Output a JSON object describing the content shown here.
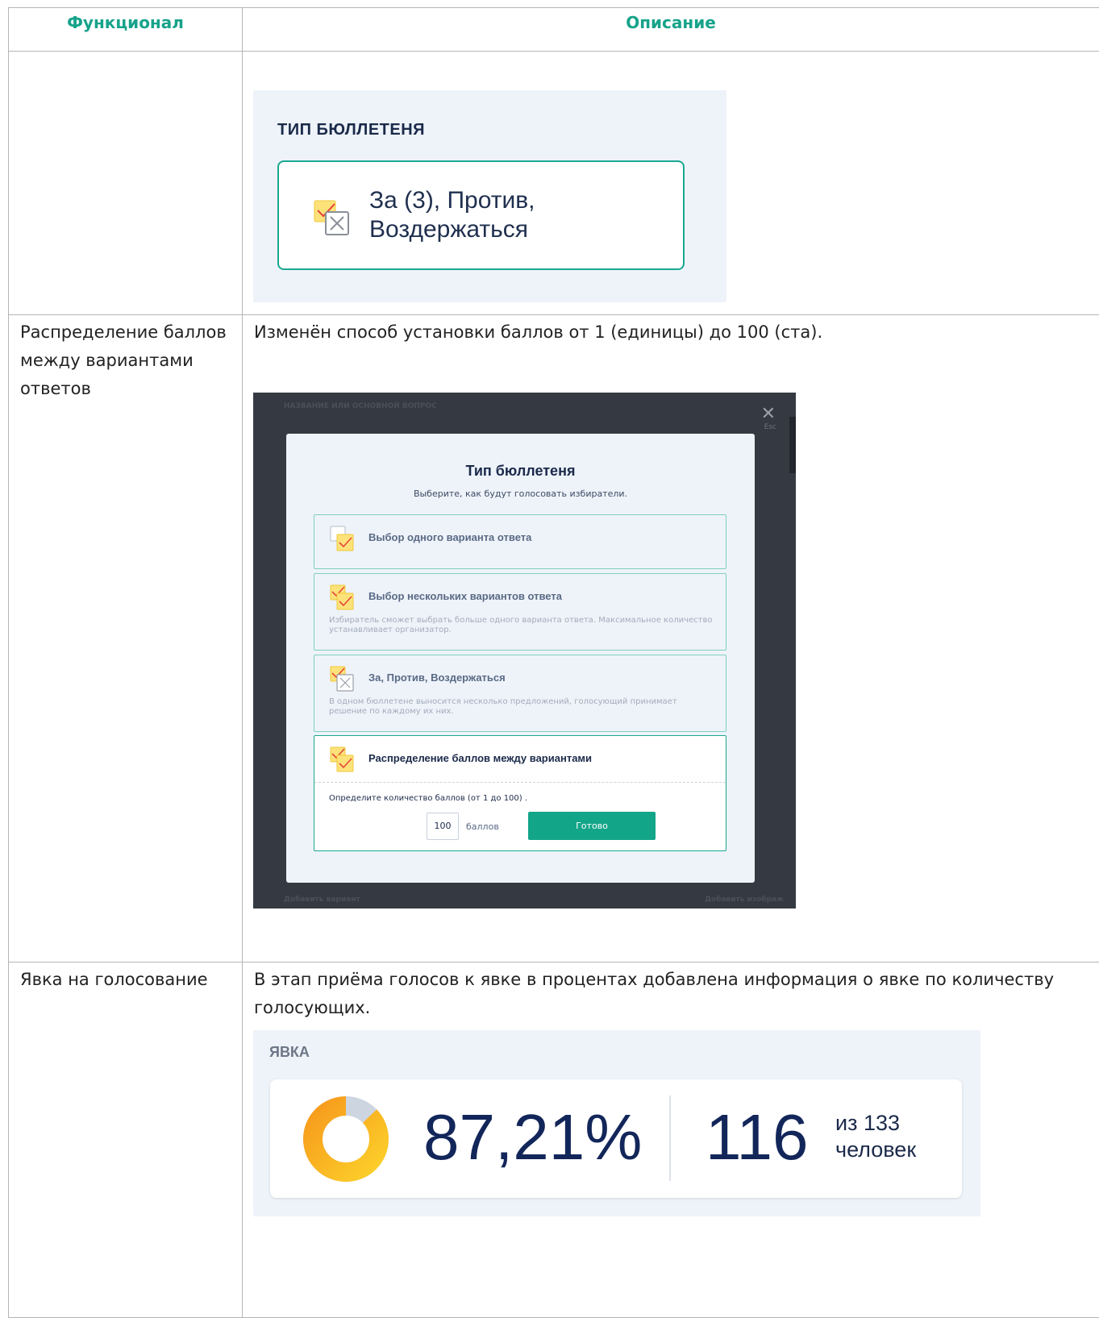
{
  "table": {
    "headers": {
      "feature": "Функционал",
      "description": "Описание"
    }
  },
  "row1": {
    "ballot_type_panel": {
      "title": "ТИП БЮЛЛЕТЕНЯ",
      "card_line1": "За (3), Против,",
      "card_line2": "Воздержаться"
    }
  },
  "row2": {
    "feature": "Распределение баллов между вариантами ответов",
    "description": "Изменён способ установки баллов от 1 (единицы) до 100 (ста).",
    "modal": {
      "bg_label_top": "НАЗВАНИЕ ИЛИ ОСНОВНОЙ ВОПРОС",
      "close_hint": "Esc",
      "bg_add_option": "Добавить вариант",
      "bg_add_image": "Добавить изображ",
      "title": "Тип бюллетеня",
      "subtitle": "Выберите, как будут голосовать избиратели.",
      "options": [
        {
          "title": "Выбор одного варианта ответа",
          "desc": ""
        },
        {
          "title": "Выбор нескольких вариантов ответа",
          "desc": "Избиратель сможет выбрать больше одного варианта ответа. Максимальное количество устанавливает организатор."
        },
        {
          "title": "За, Против, Воздержаться",
          "desc": "В одном бюллетене выносится несколько предложений, голосующий принимает решение по каждому их них."
        },
        {
          "title": "Распределение баллов между вариантами",
          "desc": ""
        }
      ],
      "points_label": "Определите количество баллов (от 1 до 100) .",
      "points_value": "100",
      "points_unit": "баллов",
      "done_button": "Готово"
    }
  },
  "row3": {
    "feature": "Явка на голосование",
    "description": "В этап приёма голосов к явке в процентах добавлена информация о явке по количеству голосующих.",
    "turnout": {
      "label": "ЯВКА",
      "percent_text": "87,21%",
      "percent_value": 87.21,
      "count": "116",
      "of_line1": "из 133",
      "of_line2": "человек",
      "colors": {
        "ring_from": "#fcd02a",
        "ring_to": "#f79a1c",
        "ring_rest": "#cdd5e0"
      }
    }
  },
  "colors": {
    "accent": "#16a38a",
    "navy": "#12265a"
  }
}
